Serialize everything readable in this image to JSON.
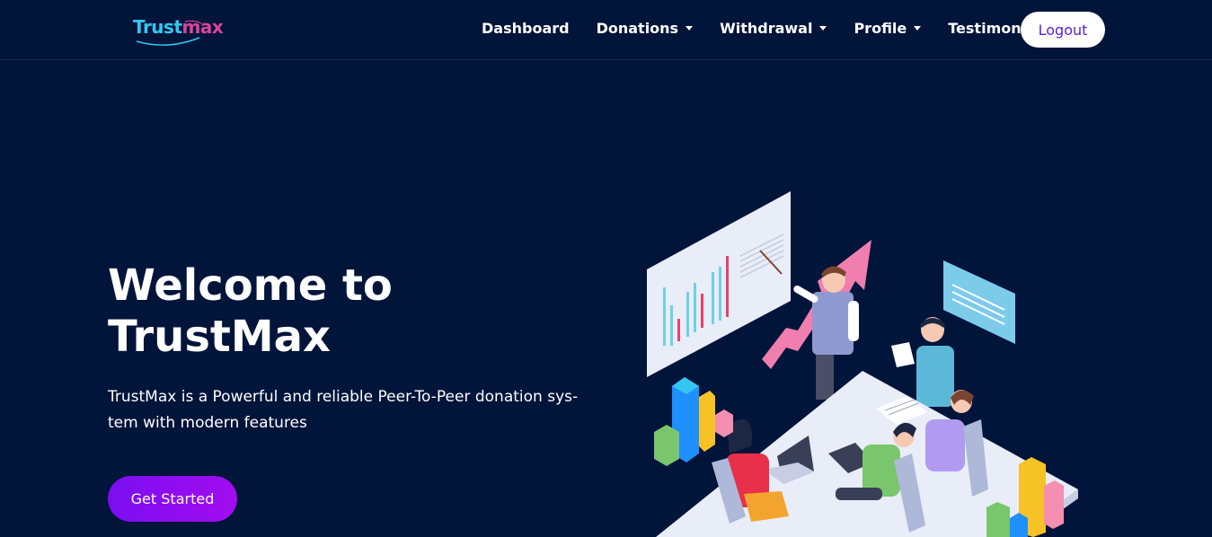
{
  "brand": {
    "logo_part1": "Trust",
    "logo_part2": "max",
    "primary_color": "#01143a",
    "accent_color": "#8a0df0"
  },
  "nav": {
    "items": [
      {
        "label": "Dashboard",
        "dropdown": false
      },
      {
        "label": "Donations",
        "dropdown": true
      },
      {
        "label": "Withdrawal",
        "dropdown": true
      },
      {
        "label": "Profile",
        "dropdown": true
      },
      {
        "label": "Testimonials",
        "dropdown": false
      }
    ],
    "logout_label": "Logout"
  },
  "hero": {
    "title_line1": "Welcome to",
    "title_line2": "TrustMax",
    "subtitle": "TrustMax is a Powerful and reliable Peer-To-Peer donation sys-tem with modern features",
    "cta_label": "Get Started",
    "illustration": "team-meeting-analytics-illustration"
  }
}
